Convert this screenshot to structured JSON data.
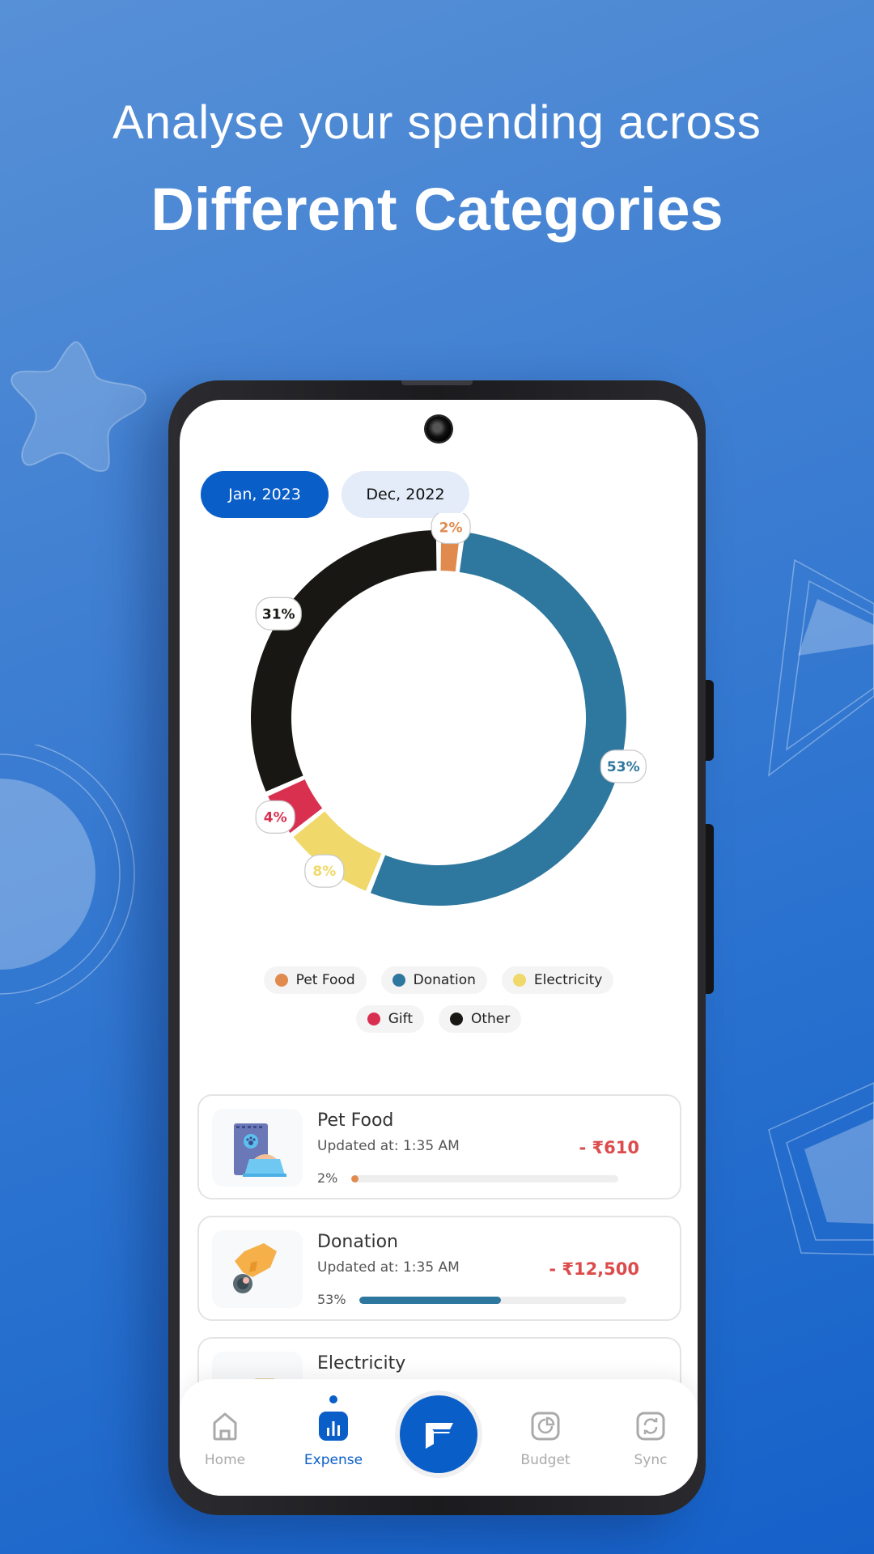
{
  "headline": {
    "line1": "Analyse your spending across",
    "line2": "Different Categories"
  },
  "months": {
    "active": "Jan, 2023",
    "inactive": "Dec, 2022"
  },
  "colors": {
    "primary": "#0a5ec8",
    "pet_food": "#e08a4e",
    "donation": "#2e779e",
    "electricity": "#f0d86a",
    "gift": "#d93050",
    "other": "#181714",
    "amount": "#dc4c4c"
  },
  "chart_data": {
    "type": "pie",
    "variant": "donut",
    "title": "",
    "start": "top",
    "direction": "clockwise",
    "slices": [
      {
        "label": "Pet Food",
        "value": 2,
        "display": "2%",
        "color": "#e08a4e"
      },
      {
        "label": "Donation",
        "value": 53,
        "display": "53%",
        "color": "#2e779e"
      },
      {
        "label": "Electricity",
        "value": 8,
        "display": "8%",
        "color": "#f0d86a"
      },
      {
        "label": "Gift",
        "value": 4,
        "display": "4%",
        "color": "#d93050"
      },
      {
        "label": "Other",
        "value": 31,
        "display": "31%",
        "color": "#181714"
      }
    ],
    "legend": [
      "Pet Food",
      "Donation",
      "Electricity",
      "Gift",
      "Other"
    ],
    "legend_position": "bottom"
  },
  "legend": [
    {
      "label": "Pet Food",
      "color": "#e08a4e"
    },
    {
      "label": "Donation",
      "color": "#2e779e"
    },
    {
      "label": "Electricity",
      "color": "#f0d86a"
    },
    {
      "label": "Gift",
      "color": "#d93050"
    },
    {
      "label": "Other",
      "color": "#181714"
    }
  ],
  "expenses": [
    {
      "title": "Pet Food",
      "updated": "Updated at: 1:35 AM",
      "amount": "- ₹610",
      "percent_label": "2%",
      "percent": 2,
      "color": "#e08a4e",
      "icon": "pet-food-icon"
    },
    {
      "title": "Donation",
      "updated": "Updated at: 1:35 AM",
      "amount": "- ₹12,500",
      "percent_label": "53%",
      "percent": 53,
      "color": "#2e779e",
      "icon": "donation-icon"
    },
    {
      "title": "Electricity",
      "icon": "electricity-icon"
    }
  ],
  "nav": {
    "items": [
      {
        "label": "Home",
        "icon": "home-icon"
      },
      {
        "label": "Expense",
        "icon": "bar-chart-icon",
        "active": true
      },
      {
        "label": "Budget",
        "icon": "pie-chart-icon"
      },
      {
        "label": "Sync",
        "icon": "sync-icon"
      }
    ],
    "fab_icon": "app-logo-icon"
  }
}
